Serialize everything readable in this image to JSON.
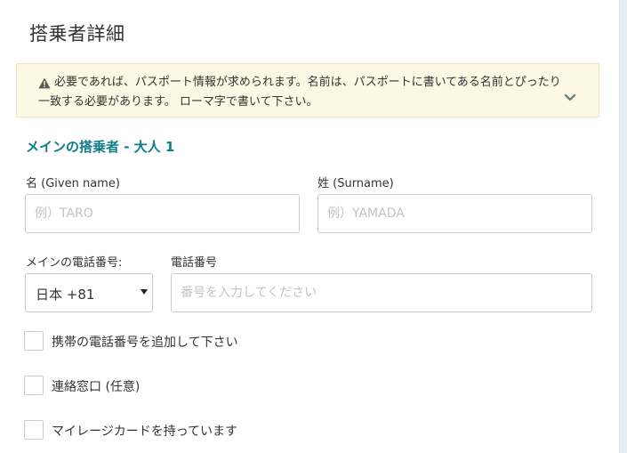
{
  "page_title": "搭乗者詳細",
  "notice": {
    "icon": "warning-icon",
    "text": "必要であれば、パスポート情報が求められます。名前は、パスポートに書いてある名前とぴったり一致する必要があります。 ローマ字で書いて下さい。",
    "toggle_icon": "chevron-down-icon",
    "background_color": "#fcf8e3"
  },
  "section_heading": "メインの搭乗者 - 大人 1",
  "accent_color": "#0f7c8a",
  "given_name": {
    "label": "名 (Given name)",
    "value": "",
    "placeholder": "例）TARO"
  },
  "surname": {
    "label": "姓 (Surname)",
    "value": "",
    "placeholder": "例）YAMADA"
  },
  "main_phone": {
    "label": "メインの電話番号:",
    "selected_country": "日本 +81"
  },
  "phone_number": {
    "label": "電話番号",
    "value": "",
    "placeholder": "番号を入力してください"
  },
  "checkboxes": [
    {
      "label": "携帯の電話番号を追加して下さい",
      "checked": false
    },
    {
      "label": "連絡窓口 (任意)",
      "checked": false
    },
    {
      "label": "マイレージカードを持っています",
      "checked": false
    }
  ]
}
